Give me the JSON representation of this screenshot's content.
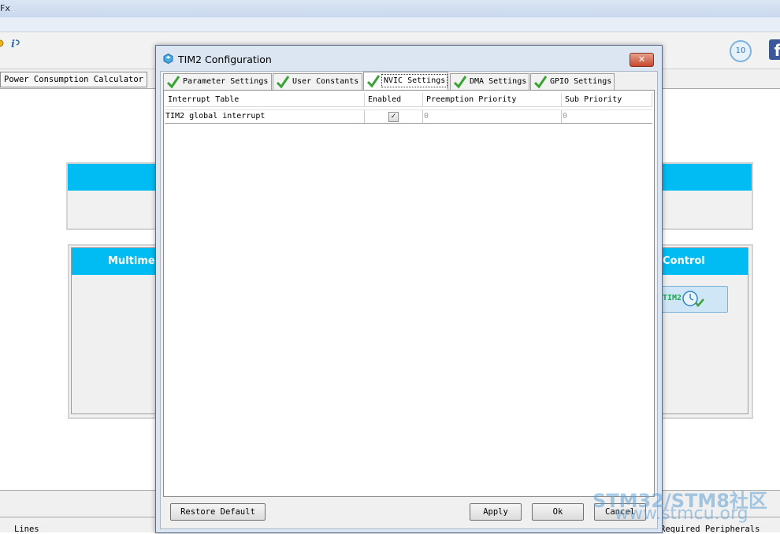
{
  "app": {
    "title_fragment": "Fx",
    "open_tab": "Power Consumption Calculator",
    "panel_left_header": "Multimed",
    "panel_right_header": "Control",
    "chip_label": "TIM2",
    "bottom_lines": "Lines",
    "bottom_required": "Required Peripherals",
    "badge_text": "10",
    "fb_glyph": "f"
  },
  "dialog": {
    "title": "TIM2 Configuration",
    "close_label": "✕",
    "tabs": [
      {
        "label": "Parameter Settings",
        "active": false
      },
      {
        "label": "User Constants",
        "active": false
      },
      {
        "label": "NVIC Settings",
        "active": true
      },
      {
        "label": "DMA Settings",
        "active": false
      },
      {
        "label": "GPIO Settings",
        "active": false
      }
    ],
    "table": {
      "headers": [
        "Interrupt Table",
        "Enabled",
        "Preemption Priority",
        "Sub Priority"
      ],
      "rows": [
        {
          "name": "TIM2 global interrupt",
          "enabled": true,
          "preemption": "0",
          "sub": "0"
        }
      ]
    },
    "buttons": {
      "restore_default": "Restore Default",
      "apply": "Apply",
      "ok": "Ok",
      "cancel": "Cancel"
    }
  },
  "watermark": {
    "brand": "STM32/STM8社区",
    "url": "www.stmcu.org"
  },
  "colors": {
    "panel_header": "#00bcf2",
    "check_green": "#3aa335",
    "chip_text": "#19a84b"
  }
}
